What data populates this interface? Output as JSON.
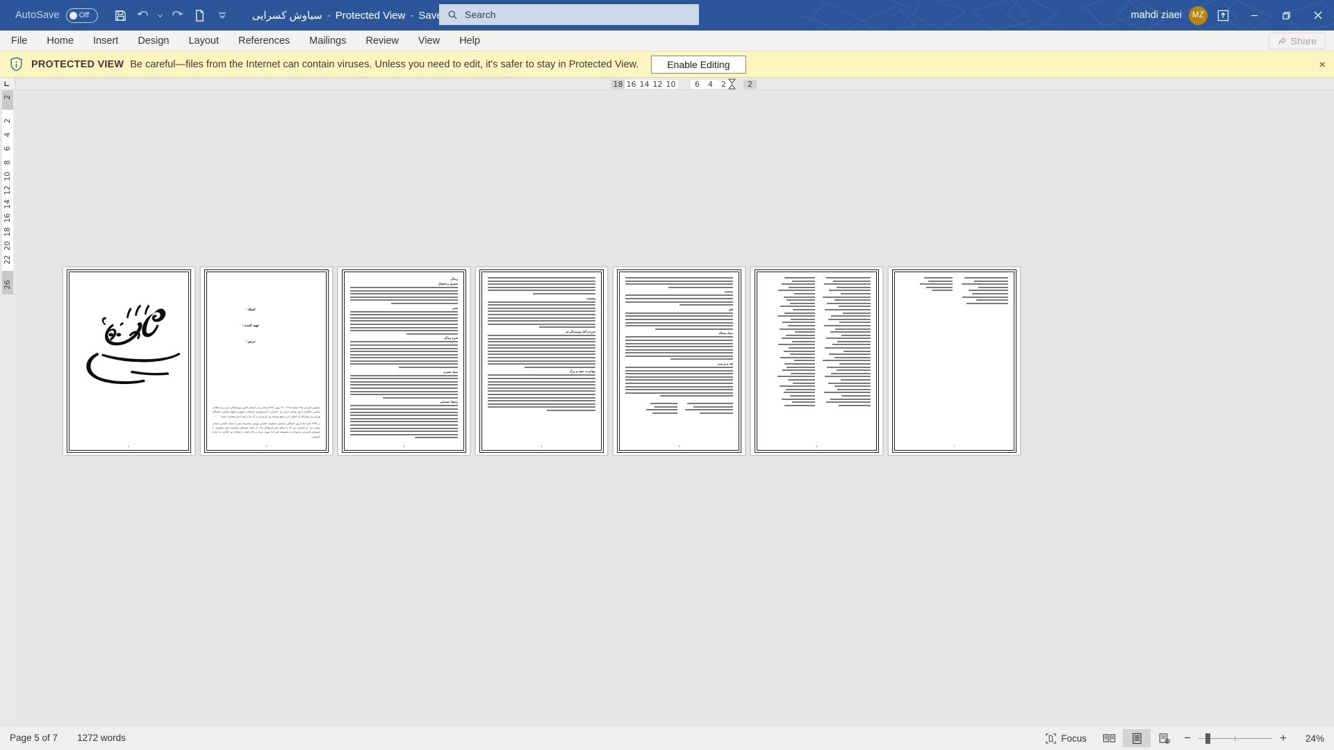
{
  "titlebar": {
    "autosave_label": "AutoSave",
    "autosave_state": "Off",
    "quick_access": [
      {
        "name": "save-icon",
        "label": "Save"
      },
      {
        "name": "undo-icon",
        "label": "Undo"
      },
      {
        "name": "undo-dropdown-icon",
        "label": "Undo options"
      },
      {
        "name": "redo-icon",
        "label": "Redo"
      },
      {
        "name": "new-blank-document-icon",
        "label": "New"
      },
      {
        "name": "customize-quick-access-toolbar-icon",
        "label": "Customize Quick Access Toolbar"
      }
    ],
    "document_name": "سیاوش کسرایی",
    "protected_state": "Protected View",
    "save_state": "Saved to this PC",
    "user_name": "mahdi ziaei",
    "user_initials": "MZ",
    "accent_color": "#2b579a",
    "avatar_color": "#b8860b",
    "window_buttons": {
      "ribbon_display": "Ribbon Display Options",
      "minimize": "Minimize",
      "restore": "Restore Down",
      "close": "Close"
    }
  },
  "search": {
    "placeholder": "Search",
    "icon": "search-icon"
  },
  "menubar": {
    "items": [
      {
        "label": "File"
      },
      {
        "label": "Home"
      },
      {
        "label": "Insert"
      },
      {
        "label": "Design"
      },
      {
        "label": "Layout"
      },
      {
        "label": "References"
      },
      {
        "label": "Mailings"
      },
      {
        "label": "Review"
      },
      {
        "label": "View"
      },
      {
        "label": "Help"
      }
    ],
    "share_label": "Share",
    "share_icon": "share-icon"
  },
  "protected_view": {
    "icon": "shield-info-icon",
    "title": "PROTECTED VIEW",
    "message": "Be careful—files from the Internet can contain viruses. Unless you need to edit, it's safer to stay in Protected View.",
    "button_label": "Enable Editing",
    "close_label": "×",
    "background_color": "#fdf4bf"
  },
  "ruler": {
    "tab_selector_icon": "left-tab-stop-icon",
    "horizontal_numbers": [
      "18",
      "16",
      "14",
      "12",
      "10",
      "",
      "6",
      "4",
      "2",
      "",
      "2"
    ],
    "vertical_numbers": [
      "2",
      "2",
      "4",
      "6",
      "8",
      "10",
      "12",
      "14",
      "16",
      "18",
      "20",
      "22",
      "26"
    ]
  },
  "document": {
    "page_count_shown": 7,
    "pages": [
      {
        "index": 1,
        "type": "bismillah-cover",
        "calligraphy": "بسم الله الرحمن الرحیم",
        "page_number": "1"
      },
      {
        "index": 2,
        "type": "title-page",
        "fields": [
          "استاد :",
          "تهیه کننده :",
          "درس :"
        ],
        "body_paragraphs": [
          "سیاوش کسرایی (۲۷ اسفند ۱۳۰۵ – ۱۹ بهمن ۱۳۷۴) شاعر و از اعضای کانون نویسندگان ایران و از فعالان سیاسی چپگرای تاریخ معاصر ایران بود. کسرایی دانش‌آموخته دانشکده حقوق و علوم سیاسی دانشگاه تهران و از بنیان‌گذاران انجمن ادبی شمع سوخته بود. او مدتی در آن حزب توده ایران فعالیت داشت.",
          "در ۱۳۳۷ قصهٔ بلند آرش کمانگیر، نخستین منظومه حماسی تهرانی مجموعهٔ شعر با سبک حماسی ایشان منتشر شد. او کسرایی بود که به سیاق شعر او وفادار ماند. از جمله شعرهای مجموعه خون سیاوش، با سرودش کسرایی، سرودان به مجموعه شعر آرا، مهره سرخ در جای خفته، ترانه‌های تو، خانگی، به دنبارهٔ خاموش."
        ],
        "page_number": "2"
      },
      {
        "index": 3,
        "type": "text-page",
        "headings": [
          "زندگی",
          "تحصیل و اشتغال",
          "شعر",
          "شرح زندگی",
          "سبک شعری",
          "رابطهٔ اجتماعی"
        ],
        "page_number": "3"
      },
      {
        "index": 4,
        "type": "text-page",
        "headings": [
          "وضعیت",
          "شرح و آغاز نویسندگی او",
          "مهاجرت، تبعید و مرگ"
        ],
        "page_number": "4"
      },
      {
        "index": 5,
        "type": "text-page",
        "headings": [
          "وضعیت",
          "قتل",
          "سبک مساله",
          "نقد و بررسی"
        ],
        "page_number": "5"
      },
      {
        "index": 6,
        "type": "poem-page",
        "page_number": "6"
      },
      {
        "index": 7,
        "type": "poem-page",
        "page_number": "7"
      }
    ]
  },
  "statusbar": {
    "page_indicator": "Page 5 of 7",
    "word_count": "1272 words",
    "focus_label": "Focus",
    "focus_icon": "focus-mode-icon",
    "view_buttons": [
      {
        "name": "read-mode-icon",
        "label": "Read Mode",
        "active": false
      },
      {
        "name": "print-layout-icon",
        "label": "Print Layout",
        "active": true
      },
      {
        "name": "web-layout-icon",
        "label": "Web Layout",
        "active": false
      }
    ],
    "zoom_out_label": "−",
    "zoom_in_label": "+",
    "zoom_level": "24%"
  }
}
